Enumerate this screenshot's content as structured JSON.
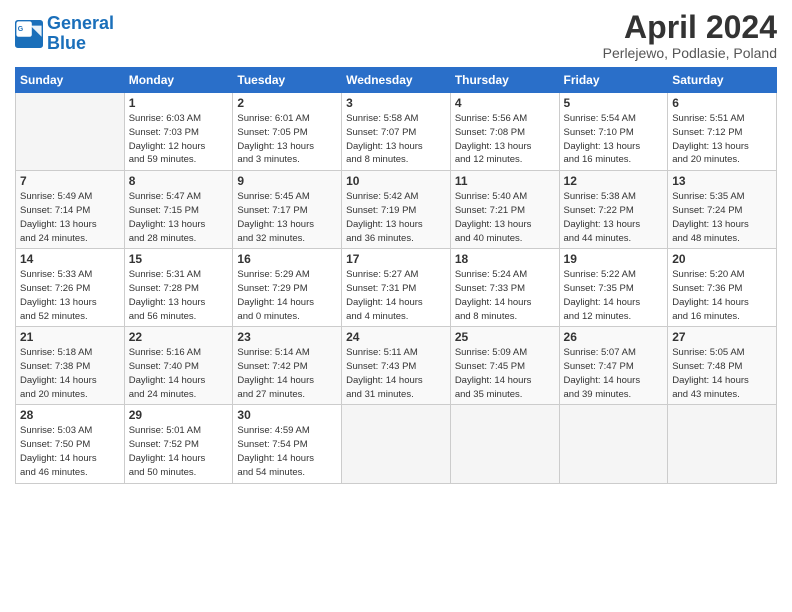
{
  "header": {
    "logo_text_general": "General",
    "logo_text_blue": "Blue",
    "month_title": "April 2024",
    "location": "Perlejewo, Podlasie, Poland"
  },
  "calendar": {
    "days_of_week": [
      "Sunday",
      "Monday",
      "Tuesday",
      "Wednesday",
      "Thursday",
      "Friday",
      "Saturday"
    ],
    "weeks": [
      [
        {
          "day": "",
          "info": ""
        },
        {
          "day": "1",
          "info": "Sunrise: 6:03 AM\nSunset: 7:03 PM\nDaylight: 12 hours\nand 59 minutes."
        },
        {
          "day": "2",
          "info": "Sunrise: 6:01 AM\nSunset: 7:05 PM\nDaylight: 13 hours\nand 3 minutes."
        },
        {
          "day": "3",
          "info": "Sunrise: 5:58 AM\nSunset: 7:07 PM\nDaylight: 13 hours\nand 8 minutes."
        },
        {
          "day": "4",
          "info": "Sunrise: 5:56 AM\nSunset: 7:08 PM\nDaylight: 13 hours\nand 12 minutes."
        },
        {
          "day": "5",
          "info": "Sunrise: 5:54 AM\nSunset: 7:10 PM\nDaylight: 13 hours\nand 16 minutes."
        },
        {
          "day": "6",
          "info": "Sunrise: 5:51 AM\nSunset: 7:12 PM\nDaylight: 13 hours\nand 20 minutes."
        }
      ],
      [
        {
          "day": "7",
          "info": "Sunrise: 5:49 AM\nSunset: 7:14 PM\nDaylight: 13 hours\nand 24 minutes."
        },
        {
          "day": "8",
          "info": "Sunrise: 5:47 AM\nSunset: 7:15 PM\nDaylight: 13 hours\nand 28 minutes."
        },
        {
          "day": "9",
          "info": "Sunrise: 5:45 AM\nSunset: 7:17 PM\nDaylight: 13 hours\nand 32 minutes."
        },
        {
          "day": "10",
          "info": "Sunrise: 5:42 AM\nSunset: 7:19 PM\nDaylight: 13 hours\nand 36 minutes."
        },
        {
          "day": "11",
          "info": "Sunrise: 5:40 AM\nSunset: 7:21 PM\nDaylight: 13 hours\nand 40 minutes."
        },
        {
          "day": "12",
          "info": "Sunrise: 5:38 AM\nSunset: 7:22 PM\nDaylight: 13 hours\nand 44 minutes."
        },
        {
          "day": "13",
          "info": "Sunrise: 5:35 AM\nSunset: 7:24 PM\nDaylight: 13 hours\nand 48 minutes."
        }
      ],
      [
        {
          "day": "14",
          "info": "Sunrise: 5:33 AM\nSunset: 7:26 PM\nDaylight: 13 hours\nand 52 minutes."
        },
        {
          "day": "15",
          "info": "Sunrise: 5:31 AM\nSunset: 7:28 PM\nDaylight: 13 hours\nand 56 minutes."
        },
        {
          "day": "16",
          "info": "Sunrise: 5:29 AM\nSunset: 7:29 PM\nDaylight: 14 hours\nand 0 minutes."
        },
        {
          "day": "17",
          "info": "Sunrise: 5:27 AM\nSunset: 7:31 PM\nDaylight: 14 hours\nand 4 minutes."
        },
        {
          "day": "18",
          "info": "Sunrise: 5:24 AM\nSunset: 7:33 PM\nDaylight: 14 hours\nand 8 minutes."
        },
        {
          "day": "19",
          "info": "Sunrise: 5:22 AM\nSunset: 7:35 PM\nDaylight: 14 hours\nand 12 minutes."
        },
        {
          "day": "20",
          "info": "Sunrise: 5:20 AM\nSunset: 7:36 PM\nDaylight: 14 hours\nand 16 minutes."
        }
      ],
      [
        {
          "day": "21",
          "info": "Sunrise: 5:18 AM\nSunset: 7:38 PM\nDaylight: 14 hours\nand 20 minutes."
        },
        {
          "day": "22",
          "info": "Sunrise: 5:16 AM\nSunset: 7:40 PM\nDaylight: 14 hours\nand 24 minutes."
        },
        {
          "day": "23",
          "info": "Sunrise: 5:14 AM\nSunset: 7:42 PM\nDaylight: 14 hours\nand 27 minutes."
        },
        {
          "day": "24",
          "info": "Sunrise: 5:11 AM\nSunset: 7:43 PM\nDaylight: 14 hours\nand 31 minutes."
        },
        {
          "day": "25",
          "info": "Sunrise: 5:09 AM\nSunset: 7:45 PM\nDaylight: 14 hours\nand 35 minutes."
        },
        {
          "day": "26",
          "info": "Sunrise: 5:07 AM\nSunset: 7:47 PM\nDaylight: 14 hours\nand 39 minutes."
        },
        {
          "day": "27",
          "info": "Sunrise: 5:05 AM\nSunset: 7:48 PM\nDaylight: 14 hours\nand 43 minutes."
        }
      ],
      [
        {
          "day": "28",
          "info": "Sunrise: 5:03 AM\nSunset: 7:50 PM\nDaylight: 14 hours\nand 46 minutes."
        },
        {
          "day": "29",
          "info": "Sunrise: 5:01 AM\nSunset: 7:52 PM\nDaylight: 14 hours\nand 50 minutes."
        },
        {
          "day": "30",
          "info": "Sunrise: 4:59 AM\nSunset: 7:54 PM\nDaylight: 14 hours\nand 54 minutes."
        },
        {
          "day": "",
          "info": ""
        },
        {
          "day": "",
          "info": ""
        },
        {
          "day": "",
          "info": ""
        },
        {
          "day": "",
          "info": ""
        }
      ]
    ]
  }
}
